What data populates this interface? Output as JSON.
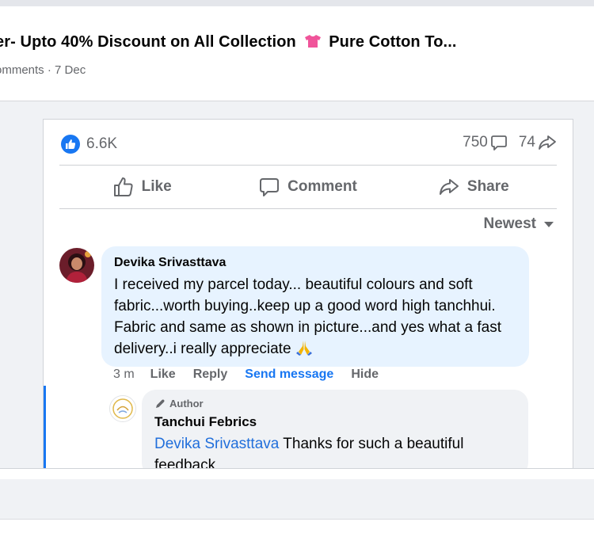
{
  "post": {
    "title_left": "er- Upto 40% Discount on All Collection",
    "title_right": "Pure Cotton To...",
    "meta": "omments · 7 Dec"
  },
  "stats": {
    "reactions": "6.6K",
    "comments": "750",
    "shares": "74"
  },
  "actions": {
    "like": "Like",
    "comment": "Comment",
    "share": "Share"
  },
  "sort": {
    "label": "Newest"
  },
  "comment": {
    "author": "Devika Srivasttava",
    "text": "I received my parcel today... beautiful colours and soft fabric...worth buying..keep up a good word high tanchhui. Fabric and same as shown in picture...and yes what a fast delivery..i really appreciate",
    "time": "3 m",
    "like": "Like",
    "reply": "Reply",
    "send_message": "Send message",
    "hide": "Hide"
  },
  "reply": {
    "badge": "Author",
    "author": "Tanchui Febrics",
    "mention": "Devika Srivasttava",
    "text": " Thanks for such a beautiful feedback"
  },
  "colors": {
    "accent": "#1877f2",
    "bubble": "#e7f3ff",
    "reply_bubble": "#f0f2f5",
    "muted": "#65676b"
  },
  "icons": {
    "reaction": "like-thumb-icon",
    "comment_count": "speech-bubble-icon",
    "share_count": "share-arrow-icon",
    "sort": "caret-down-icon",
    "author_badge": "pen-icon",
    "emoji_title": "t-shirt-emoji-icon",
    "emoji_comment": "folded-hands-emoji-icon"
  }
}
